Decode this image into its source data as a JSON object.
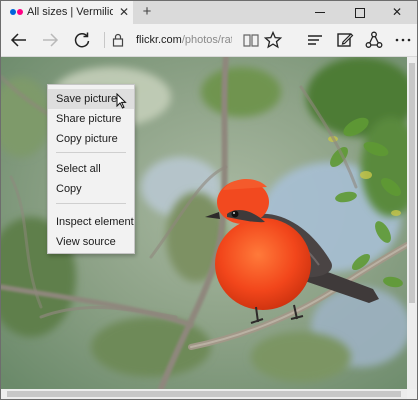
{
  "browser": {
    "tab": {
      "title": "All sizes | Vermilion Flyca",
      "close_glyph": "✕"
    },
    "new_tab_glyph": "+",
    "window_controls": {
      "close_glyph": "✕"
    },
    "address": {
      "domain": "flickr.com",
      "path": "/photos/rathbc"
    },
    "icons": {
      "favicon": "flickr-logo-icon",
      "back": "arrow-left-icon",
      "forward": "arrow-right-icon",
      "refresh": "refresh-icon",
      "lock": "lock-icon",
      "reading_view": "book-icon",
      "favorite": "star-icon",
      "hub": "hub-lines-icon",
      "web_note": "pen-square-icon",
      "share": "share-icon",
      "more": "ellipsis-icon"
    },
    "colors": {
      "flickr_blue": "#0063dc",
      "flickr_pink": "#ff0084"
    }
  },
  "page": {
    "image_subject": "Vermilion Flycatcher"
  },
  "context_menu": {
    "items": [
      {
        "label": "Save picture",
        "highlighted": true
      },
      {
        "label": "Share picture"
      },
      {
        "label": "Copy picture"
      },
      {
        "label": "Select all"
      },
      {
        "label": "Copy"
      },
      {
        "label": "Inspect element"
      },
      {
        "label": "View source"
      }
    ]
  }
}
